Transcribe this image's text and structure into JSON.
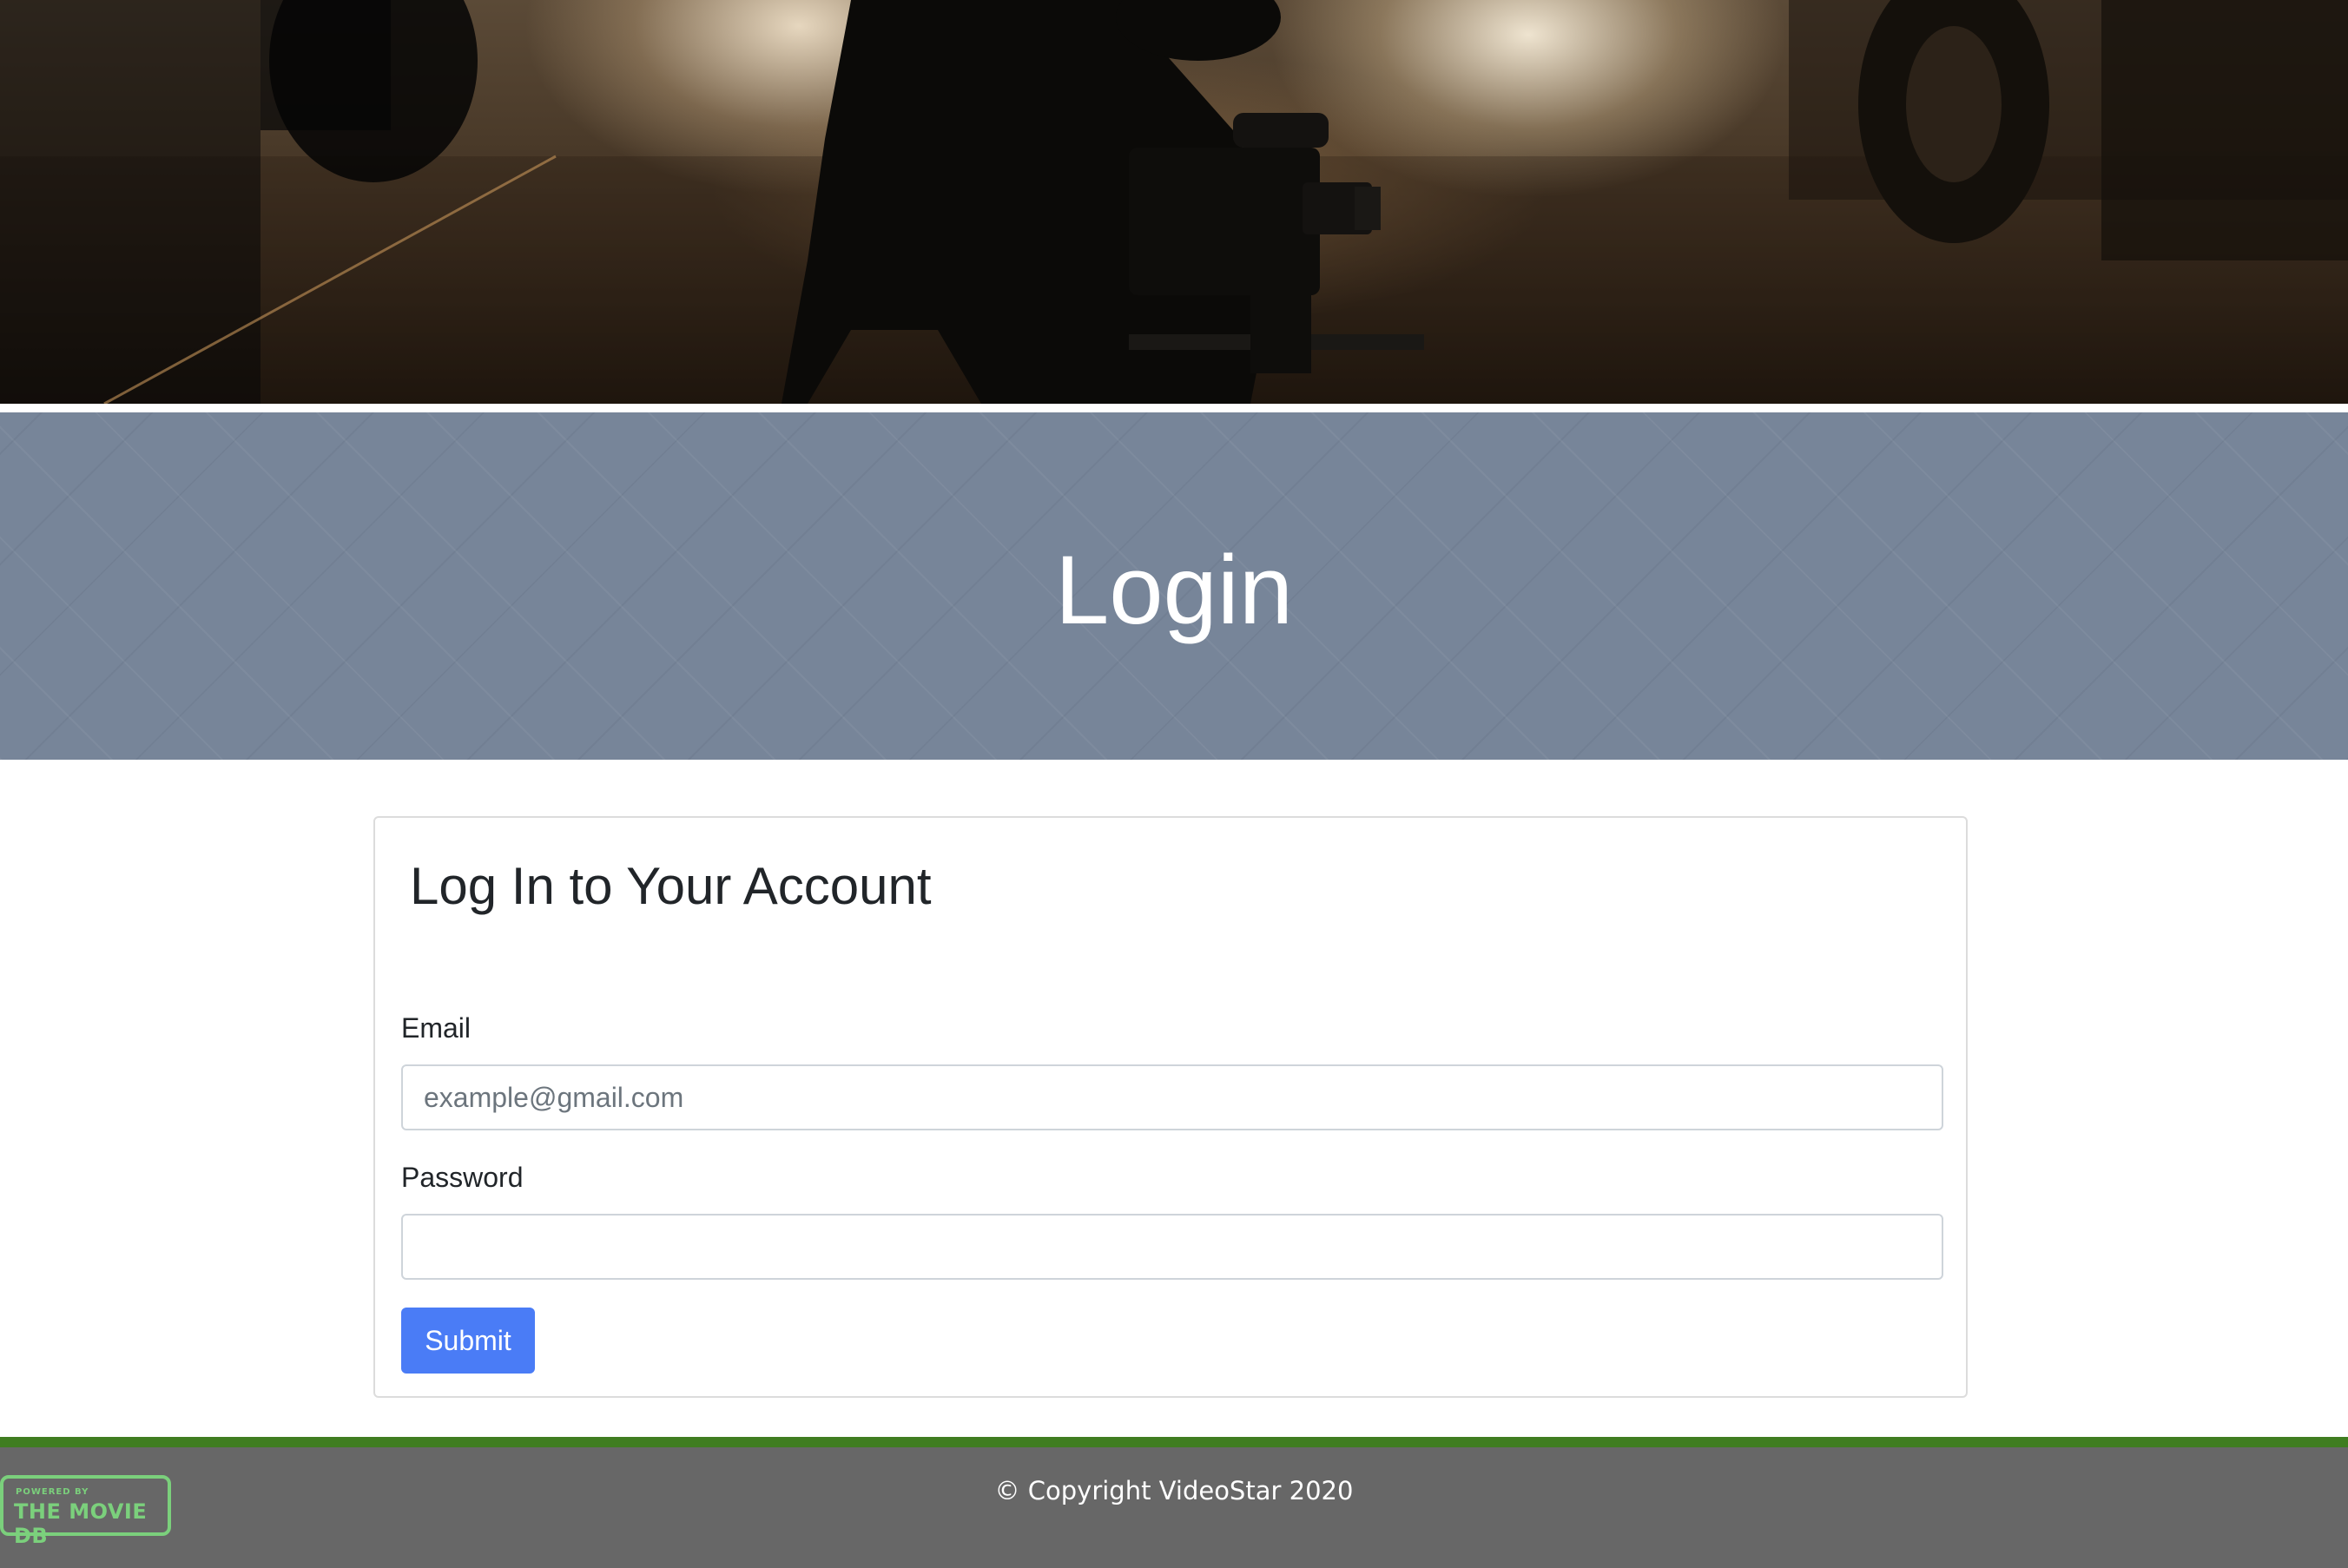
{
  "hero": {
    "image_icon": "filmmaker-camera-photo"
  },
  "banner": {
    "title": "Login",
    "background_color": "#778599"
  },
  "login_card": {
    "heading": "Log In to Your Account",
    "email_label": "Email",
    "email_placeholder": "example@gmail.com",
    "email_value": "",
    "password_label": "Password",
    "password_value": "",
    "submit_label": "Submit",
    "submit_color": "#4a7cf6"
  },
  "footer": {
    "copyright": "© Copyright VideoStar 2020",
    "stripe_color": "#3f7d20",
    "background_color": "#676767",
    "badge_small_text": "POWERED BY",
    "badge_text": "THE MOVIE DB",
    "badge_color": "#7bd07c",
    "badge_icon": "tmdb-logo"
  }
}
